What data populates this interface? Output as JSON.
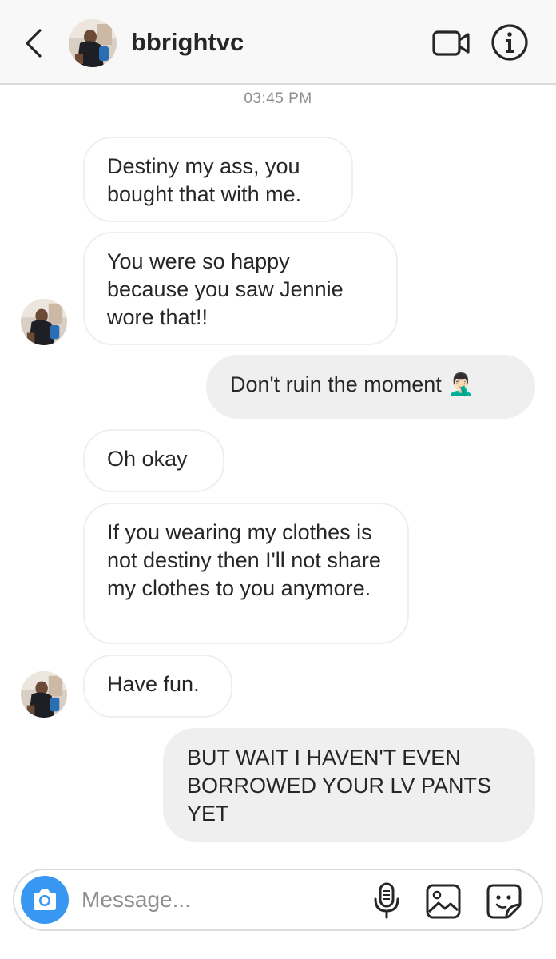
{
  "header": {
    "username": "bbrightvc",
    "icons": {
      "back": "chevron-left-icon",
      "video": "video-call-icon",
      "info": "info-icon"
    }
  },
  "timestamp": "03:45 PM",
  "messages": [
    {
      "direction": "incoming",
      "text": "Destiny my ass, you bought that with me."
    },
    {
      "direction": "incoming",
      "text": "You were so happy because you saw Jennie wore that!!"
    },
    {
      "direction": "outgoing",
      "text": "Don't ruin the moment 🤦🏻‍♂️"
    },
    {
      "direction": "incoming",
      "text": "Oh okay"
    },
    {
      "direction": "incoming",
      "text": "If you wearing my clothes is not destiny then I'll not share my clothes to you anymore."
    },
    {
      "direction": "incoming",
      "text": "Have fun."
    },
    {
      "direction": "outgoing",
      "text": "BUT WAIT I HAVEN'T EVEN BORROWED YOUR LV PANTS YET"
    }
  ],
  "composer": {
    "placeholder": "Message...",
    "icons": [
      "camera-icon",
      "microphone-icon",
      "gallery-icon",
      "sticker-icon"
    ]
  },
  "colors": {
    "accent": "#3897f0",
    "outgoing_bubble": "#efefef",
    "incoming_border": "#efefef",
    "muted_text": "#8e8e8e"
  }
}
